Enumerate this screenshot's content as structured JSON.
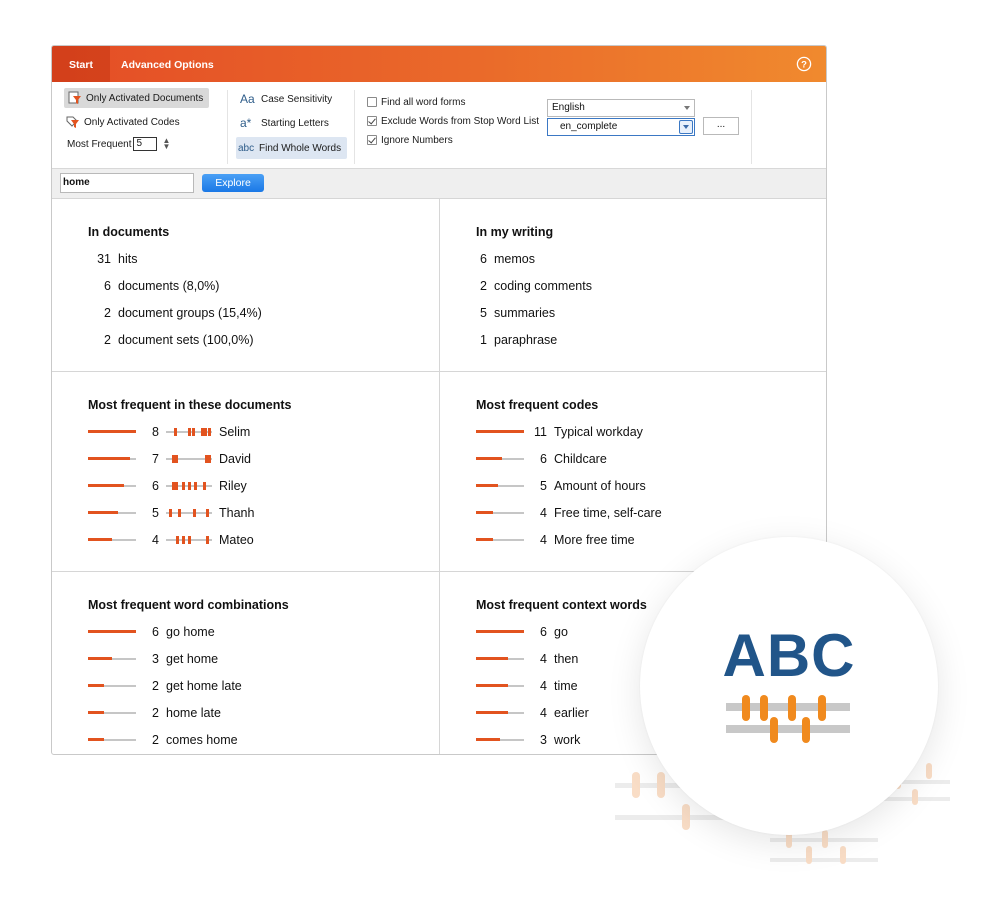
{
  "tabs": {
    "start": "Start",
    "advanced": "Advanced Options"
  },
  "ribbon": {
    "only_activated_documents": "Only Activated Documents",
    "only_activated_codes": "Only Activated Codes",
    "most_frequent_label": "Most Frequent",
    "most_frequent_value": "5",
    "case_sensitivity": "Case Sensitivity",
    "starting_letters": "Starting Letters",
    "find_whole_words": "Find Whole Words",
    "glyph_case": "Aa",
    "glyph_starting": "a*",
    "glyph_whole": "abc",
    "find_all_word_forms": {
      "label": "Find all word forms",
      "checked": false
    },
    "exclude_stop_words": {
      "label": "Exclude Words from Stop Word List",
      "checked": true
    },
    "ignore_numbers": {
      "label": "Ignore Numbers",
      "checked": true
    },
    "language": "English",
    "stop_list": "en_complete",
    "more_button": "..."
  },
  "search": {
    "value": "home",
    "explore_label": "Explore"
  },
  "panels": {
    "in_documents": {
      "title": "In documents",
      "rows": [
        {
          "n": "31",
          "label": "hits"
        },
        {
          "n": "6",
          "label": "documents (8,0%)"
        },
        {
          "n": "2",
          "label": "document groups (15,4%)"
        },
        {
          "n": "2",
          "label": "document sets (100,0%)"
        }
      ]
    },
    "in_my_writing": {
      "title": "In my writing",
      "rows": [
        {
          "n": "6",
          "label": "memos"
        },
        {
          "n": "2",
          "label": "coding comments"
        },
        {
          "n": "5",
          "label": "summaries"
        },
        {
          "n": "1",
          "label": "paraphrase"
        }
      ]
    },
    "most_frequent_documents": {
      "title": "Most frequent in these documents",
      "rows": [
        {
          "n": "8",
          "label": "Selim",
          "value": 8
        },
        {
          "n": "7",
          "label": "David",
          "value": 7
        },
        {
          "n": "6",
          "label": "Riley",
          "value": 6
        },
        {
          "n": "5",
          "label": "Thanh",
          "value": 5
        },
        {
          "n": "4",
          "label": "Mateo",
          "value": 4
        }
      ]
    },
    "most_frequent_codes": {
      "title": "Most frequent codes",
      "rows": [
        {
          "n": "11",
          "label": "Typical workday",
          "value": 11
        },
        {
          "n": "6",
          "label": "Childcare",
          "value": 6
        },
        {
          "n": "5",
          "label": "Amount of hours",
          "value": 5
        },
        {
          "n": "4",
          "label": "Free time, self-care",
          "value": 4
        },
        {
          "n": "4",
          "label": "More free time",
          "value": 4
        }
      ]
    },
    "word_combinations": {
      "title": "Most frequent word combinations",
      "rows": [
        {
          "n": "6",
          "label": "go home",
          "value": 6
        },
        {
          "n": "3",
          "label": "get home",
          "value": 3
        },
        {
          "n": "2",
          "label": "get home late",
          "value": 2
        },
        {
          "n": "2",
          "label": "home late",
          "value": 2
        },
        {
          "n": "2",
          "label": "comes home",
          "value": 2
        }
      ]
    },
    "context_words": {
      "title": "Most frequent context words",
      "rows": [
        {
          "n": "6",
          "label": "go",
          "value": 6
        },
        {
          "n": "4",
          "label": "then",
          "value": 4
        },
        {
          "n": "4",
          "label": "time",
          "value": 4
        },
        {
          "n": "4",
          "label": "earlier",
          "value": 4
        },
        {
          "n": "3",
          "label": "work",
          "value": 3
        }
      ]
    }
  },
  "badge": {
    "text": "ABC"
  },
  "colors": {
    "accent": "#e2531f",
    "tab_gradient_start": "#e44d26",
    "tab_gradient_end": "#f08a2e",
    "badge_text": "#215589",
    "badge_marks": "#f08a1e"
  },
  "icons": [
    "help-icon",
    "filter-document-icon",
    "filter-code-icon",
    "spinner-icon",
    "checkbox-icon",
    "dropdown-arrow-icon",
    "abc-words-icon"
  ]
}
